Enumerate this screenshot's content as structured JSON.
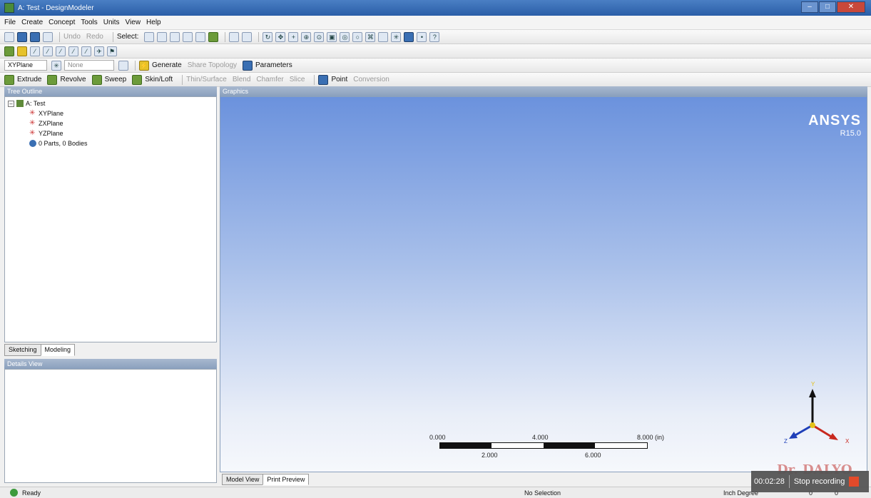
{
  "window": {
    "title": "A: Test - DesignModeler"
  },
  "menu": [
    "File",
    "Create",
    "Concept",
    "Tools",
    "Units",
    "View",
    "Help"
  ],
  "toolbar1": {
    "undo": "Undo",
    "redo": "Redo",
    "select": "Select:"
  },
  "toolbar3": {
    "plane": "XYPlane",
    "sketch": "None",
    "generate": "Generate",
    "share_topology": "Share Topology",
    "parameters": "Parameters"
  },
  "toolbar4": {
    "extrude": "Extrude",
    "revolve": "Revolve",
    "sweep": "Sweep",
    "skin_loft": "Skin/Loft",
    "thin_surface": "Thin/Surface",
    "blend": "Blend",
    "chamfer": "Chamfer",
    "slice": "Slice",
    "point": "Point",
    "conversion": "Conversion"
  },
  "tree": {
    "header": "Tree Outline",
    "root": "A: Test",
    "items": [
      "XYPlane",
      "ZXPlane",
      "YZPlane",
      "0 Parts, 0 Bodies"
    ]
  },
  "left_tabs": [
    "Sketching",
    "Modeling"
  ],
  "details": {
    "header": "Details View"
  },
  "graphics": {
    "header": "Graphics",
    "brand": "ANSYS",
    "release": "R15.0",
    "scale_top": [
      "0.000",
      "4.000",
      "8.000 (in)"
    ],
    "scale_bottom": [
      "2.000",
      "6.000"
    ],
    "axes": {
      "y": "Y",
      "x": "X",
      "z": "Z"
    },
    "watermark": "Dr. DALYO"
  },
  "graphics_tabs": [
    "Model View",
    "Print Preview"
  ],
  "status": {
    "ready": "Ready",
    "selection": "No Selection",
    "units": "Inch  Degree",
    "val1": "0",
    "val2": "0"
  },
  "recording": {
    "time": "00:02:28",
    "label": "Stop recording"
  }
}
